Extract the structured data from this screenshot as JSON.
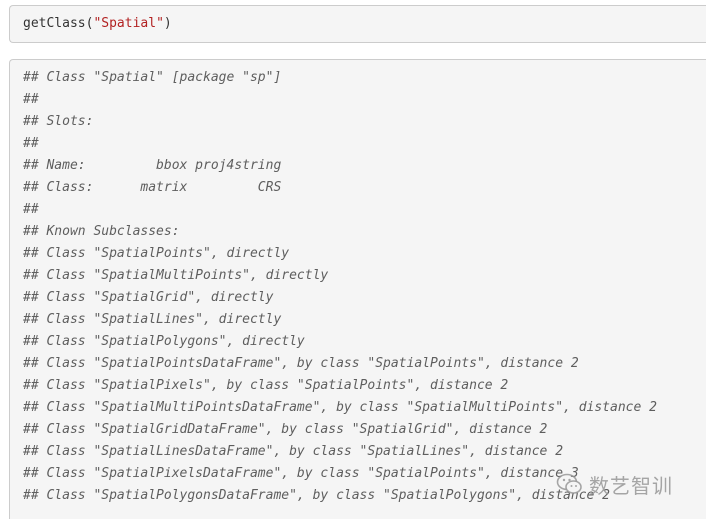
{
  "input": {
    "func": "getClass(",
    "arg": "\"Spatial\"",
    "close": ")"
  },
  "output": {
    "lines": [
      "## Class \"Spatial\" [package \"sp\"]",
      "##",
      "## Slots:",
      "##",
      "## Name:         bbox proj4string",
      "## Class:      matrix         CRS",
      "##",
      "## Known Subclasses:",
      "## Class \"SpatialPoints\", directly",
      "## Class \"SpatialMultiPoints\", directly",
      "## Class \"SpatialGrid\", directly",
      "## Class \"SpatialLines\", directly",
      "## Class \"SpatialPolygons\", directly",
      "## Class \"SpatialPointsDataFrame\", by class \"SpatialPoints\", distance 2",
      "## Class \"SpatialPixels\", by class \"SpatialPoints\", distance 2",
      "## Class \"SpatialMultiPointsDataFrame\", by class \"SpatialMultiPoints\", distance 2",
      "## Class \"SpatialGridDataFrame\", by class \"SpatialGrid\", distance 2",
      "## Class \"SpatialLinesDataFrame\", by class \"SpatialLines\", distance 2",
      "## Class \"SpatialPixelsDataFrame\", by class \"SpatialPoints\", distance 3",
      "## Class \"SpatialPolygonsDataFrame\", by class \"SpatialPolygons\", distance 2"
    ]
  },
  "watermark": {
    "text": "数艺智训",
    "icon": "wechat-icon"
  }
}
